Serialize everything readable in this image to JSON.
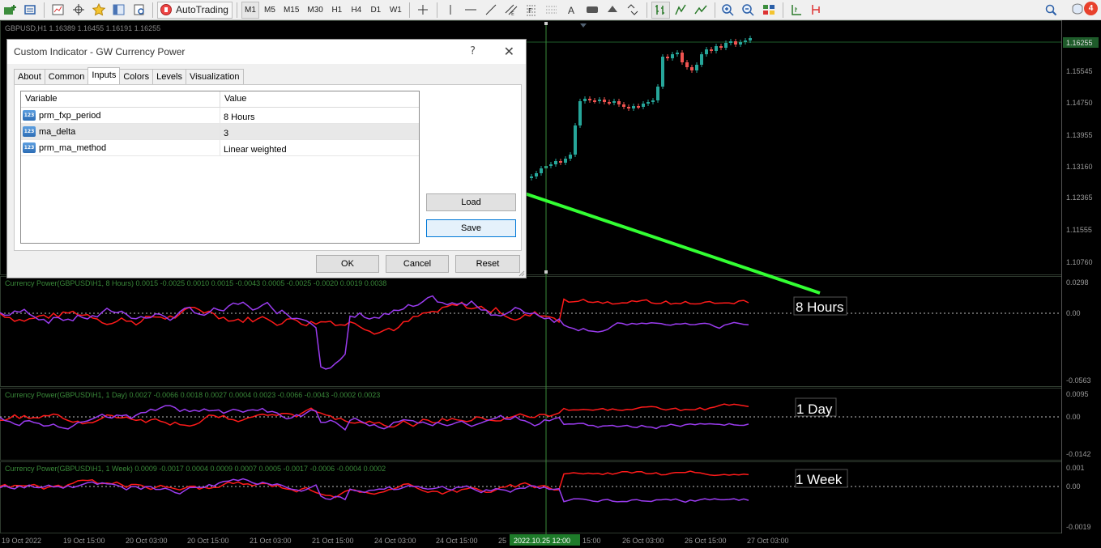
{
  "toolbar": {
    "autotrading_label": "AutoTrading",
    "timeframes": [
      "M1",
      "M5",
      "M15",
      "M30",
      "H1",
      "H4",
      "D1",
      "W1"
    ],
    "notification_count": "4"
  },
  "chart": {
    "header": "GBPUSD,H1  1.16389 1.16455 1.16191 1.16255",
    "current_price": "1.16255",
    "price_ticks": [
      "1.15545",
      "1.14750",
      "1.13955",
      "1.13160",
      "1.12365",
      "1.11555",
      "1.10760"
    ],
    "colors": {
      "bull": "#26a69a",
      "bear": "#ef5350",
      "background": "#000000",
      "grid": "#1f2a1f",
      "series_red": "#ff1a1a",
      "series_purple": "#9b3cf0",
      "arrow": "#33ff33"
    }
  },
  "indicators": [
    {
      "header": "Currency Power(GBPUSD\\H1, 8 Hours) 0.0015 -0.0025 0.0010 0.0015 -0.0043 0.0005 -0.0025 -0.0020 0.0019 0.0038",
      "annotation": "8 Hours",
      "ticks": [
        "0.0298",
        "0.00",
        "-0.0563"
      ]
    },
    {
      "header": "Currency Power(GBPUSD\\H1, 1 Day) 0.0027 -0.0066 0.0018 0.0027 0.0004 0.0023 -0.0066 -0.0043 -0.0002 0.0023",
      "annotation": "1 Day",
      "ticks": [
        "0.0095",
        "0.00",
        "-0.0142"
      ]
    },
    {
      "header": "Currency Power(GBPUSD\\H1, 1 Week) 0.0009 -0.0017 0.0004 0.0009 0.0007 0.0005 -0.0017 -0.0006 -0.0004 0.0002",
      "annotation": "1 Week",
      "ticks": [
        "0.001",
        "0.00",
        "-0.0019"
      ]
    }
  ],
  "time_axis": {
    "labels": [
      "19 Oct 2022",
      "19 Oct 15:00",
      "20 Oct 03:00",
      "20 Oct 15:00",
      "21 Oct 03:00",
      "21 Oct 15:00",
      "24 Oct 03:00",
      "24 Oct 15:00",
      "25",
      "26 Oct 03:00",
      "26 Oct 15:00",
      "27 Oct 03:00"
    ],
    "crosshair_label": "2022.10.25 12:00",
    "crosshair_tail": "15:00"
  },
  "dialog": {
    "title": "Custom Indicator - GW Currency Power",
    "help": "?",
    "tabs": [
      "About",
      "Common",
      "Inputs",
      "Colors",
      "Levels",
      "Visualization"
    ],
    "active_tab": "Inputs",
    "columns": {
      "variable": "Variable",
      "value": "Value"
    },
    "params": [
      {
        "icon": "123",
        "name": "prm_fxp_period",
        "value": "8 Hours"
      },
      {
        "icon": "123",
        "name": "ma_delta",
        "value": "3"
      },
      {
        "icon": "123",
        "name": "prm_ma_method",
        "value": "Linear weighted"
      }
    ],
    "buttons": {
      "load": "Load",
      "save": "Save",
      "ok": "OK",
      "cancel": "Cancel",
      "reset": "Reset"
    }
  }
}
